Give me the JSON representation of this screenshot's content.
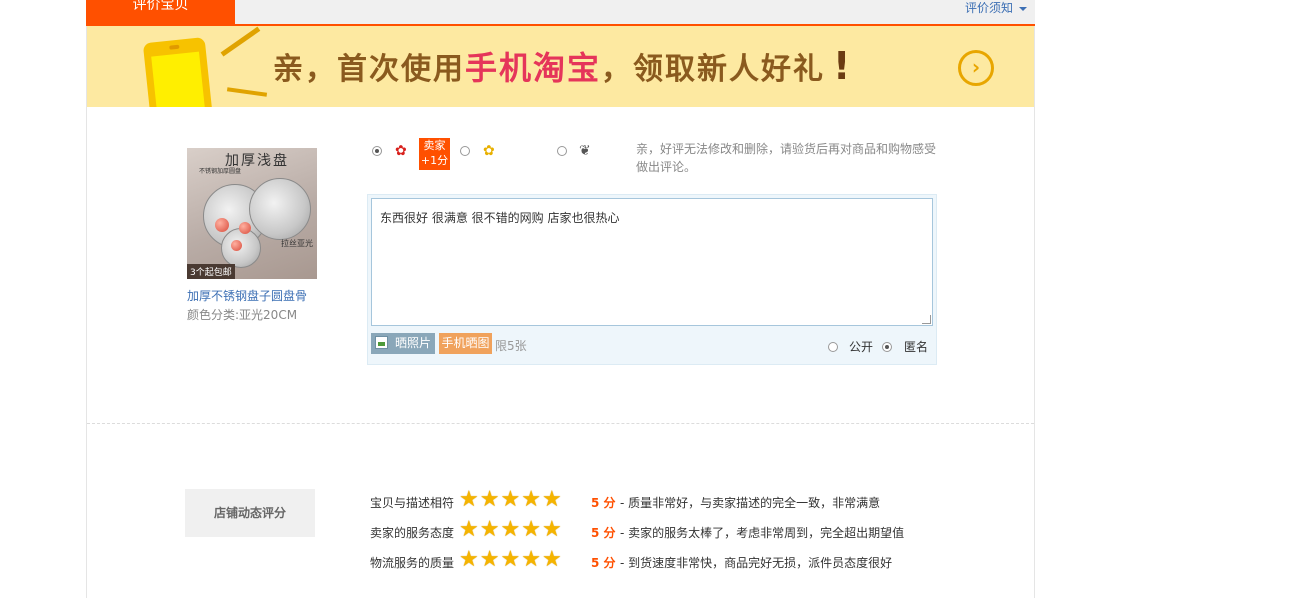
{
  "header": {
    "active_tab": "评价宝贝",
    "notice_link": "评价须知"
  },
  "banner": {
    "text_before": "亲，首次使用",
    "highlight": "手机淘宝",
    "text_after": "，领取新人好礼",
    "excl": "!",
    "arrow": "›"
  },
  "product": {
    "image_title": "加厚浅盘",
    "image_subtitle": "不锈钢加厚圆盘",
    "image_corner": "3个起包邮",
    "image_tag": "拉丝亚光",
    "name": "加厚不锈钢盘子圆盘骨",
    "sku": "颜色分类:亚光20CM"
  },
  "rating_options": {
    "selected": "good",
    "seller_badge_line1": "卖家",
    "seller_badge_line2": "+1分",
    "good_icon": "red-flower-icon",
    "neutral_icon": "yellow-flower-icon",
    "bad_icon": "wilted-flower-icon",
    "hint": "亲，好评无法修改和删除，请验货后再对商品和购物感受做出评论。"
  },
  "comment": {
    "text": "东西很好 很满意 很不错的网购 店家也很热心",
    "photo_button": "晒照片",
    "mobile_button": "手机晒图",
    "limit": "限5张",
    "public_label": "公开",
    "anonymous_label": "匿名",
    "visibility": "anonymous"
  },
  "shop_rating": {
    "label": "店铺动态评分",
    "rows": [
      {
        "label": "宝贝与描述相符",
        "stars": 5,
        "score": "5 分",
        "desc": "- 质量非常好，与卖家描述的完全一致，非常满意"
      },
      {
        "label": "卖家的服务态度",
        "stars": 5,
        "score": "5 分",
        "desc": "- 卖家的服务太棒了，考虑非常周到，完全超出期望值"
      },
      {
        "label": "物流服务的质量",
        "stars": 5,
        "score": "5 分",
        "desc": "- 到货速度非常快，商品完好无损，派件员态度很好"
      }
    ]
  }
}
